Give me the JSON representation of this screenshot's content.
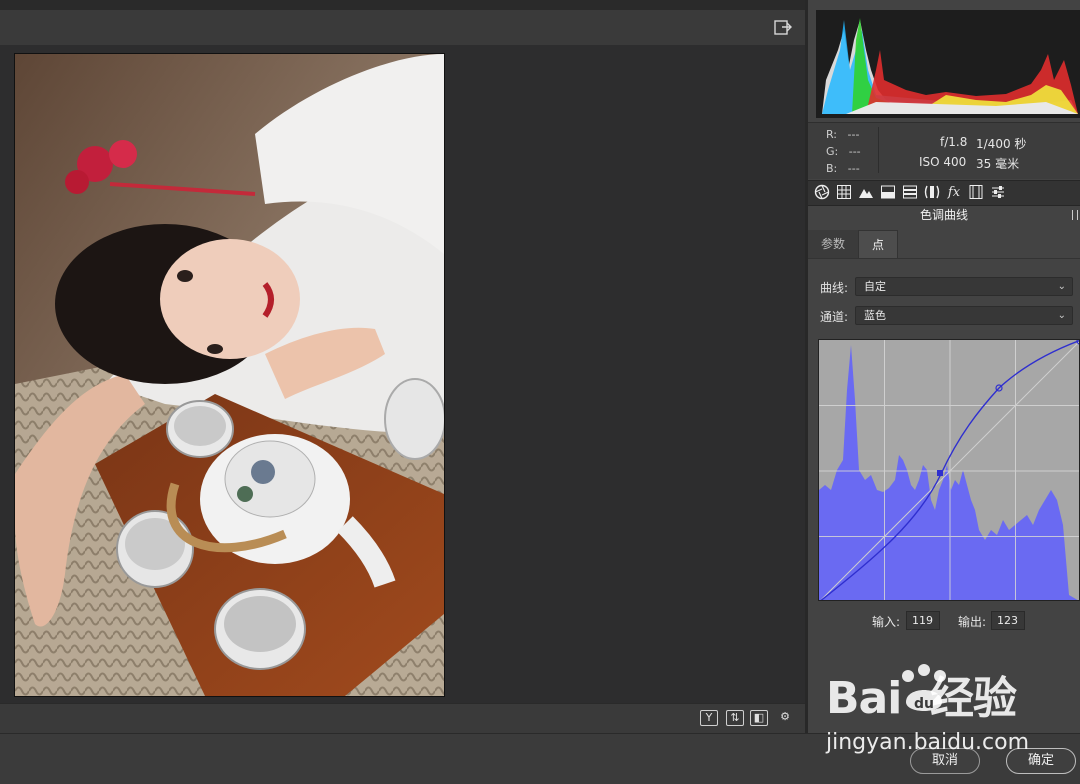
{
  "editor": {
    "zoom_icon": "open-output-icon",
    "footer_tools": [
      "Y",
      "⇅",
      "◧",
      "⚙"
    ]
  },
  "readout": {
    "r_label": "R:",
    "r_value": "---",
    "g_label": "G:",
    "g_value": "---",
    "b_label": "B:",
    "b_value": "---",
    "aperture": "f/1.8",
    "shutter": "1/400 秒",
    "iso": "ISO 400",
    "focal": "35 毫米"
  },
  "panel": {
    "title": "色调曲线",
    "tabs": [
      "basic-aperture-icon",
      "grid-icon",
      "mountain-icon",
      "split-icon",
      "strip-icon",
      "lens-icon",
      "fx-icon",
      "film-icon",
      "sliders-icon"
    ],
    "subtabs": {
      "params": "参数",
      "point": "点"
    },
    "curve_label": "曲线:",
    "curve_value": "自定",
    "channel_label": "通道:",
    "channel_value": "蓝色",
    "input_label": "输入:",
    "input_value": "119",
    "output_label": "输出:",
    "output_value": "123"
  },
  "buttons": {
    "cancel": "取消",
    "ok": "确定"
  },
  "watermark": {
    "logo": "Bai  经验",
    "url": "jingyan.baidu.com"
  },
  "colors": {
    "curve_line": "#3a3ad0",
    "histogram_blue": "#6868f0",
    "panel_bg": "#434343"
  }
}
